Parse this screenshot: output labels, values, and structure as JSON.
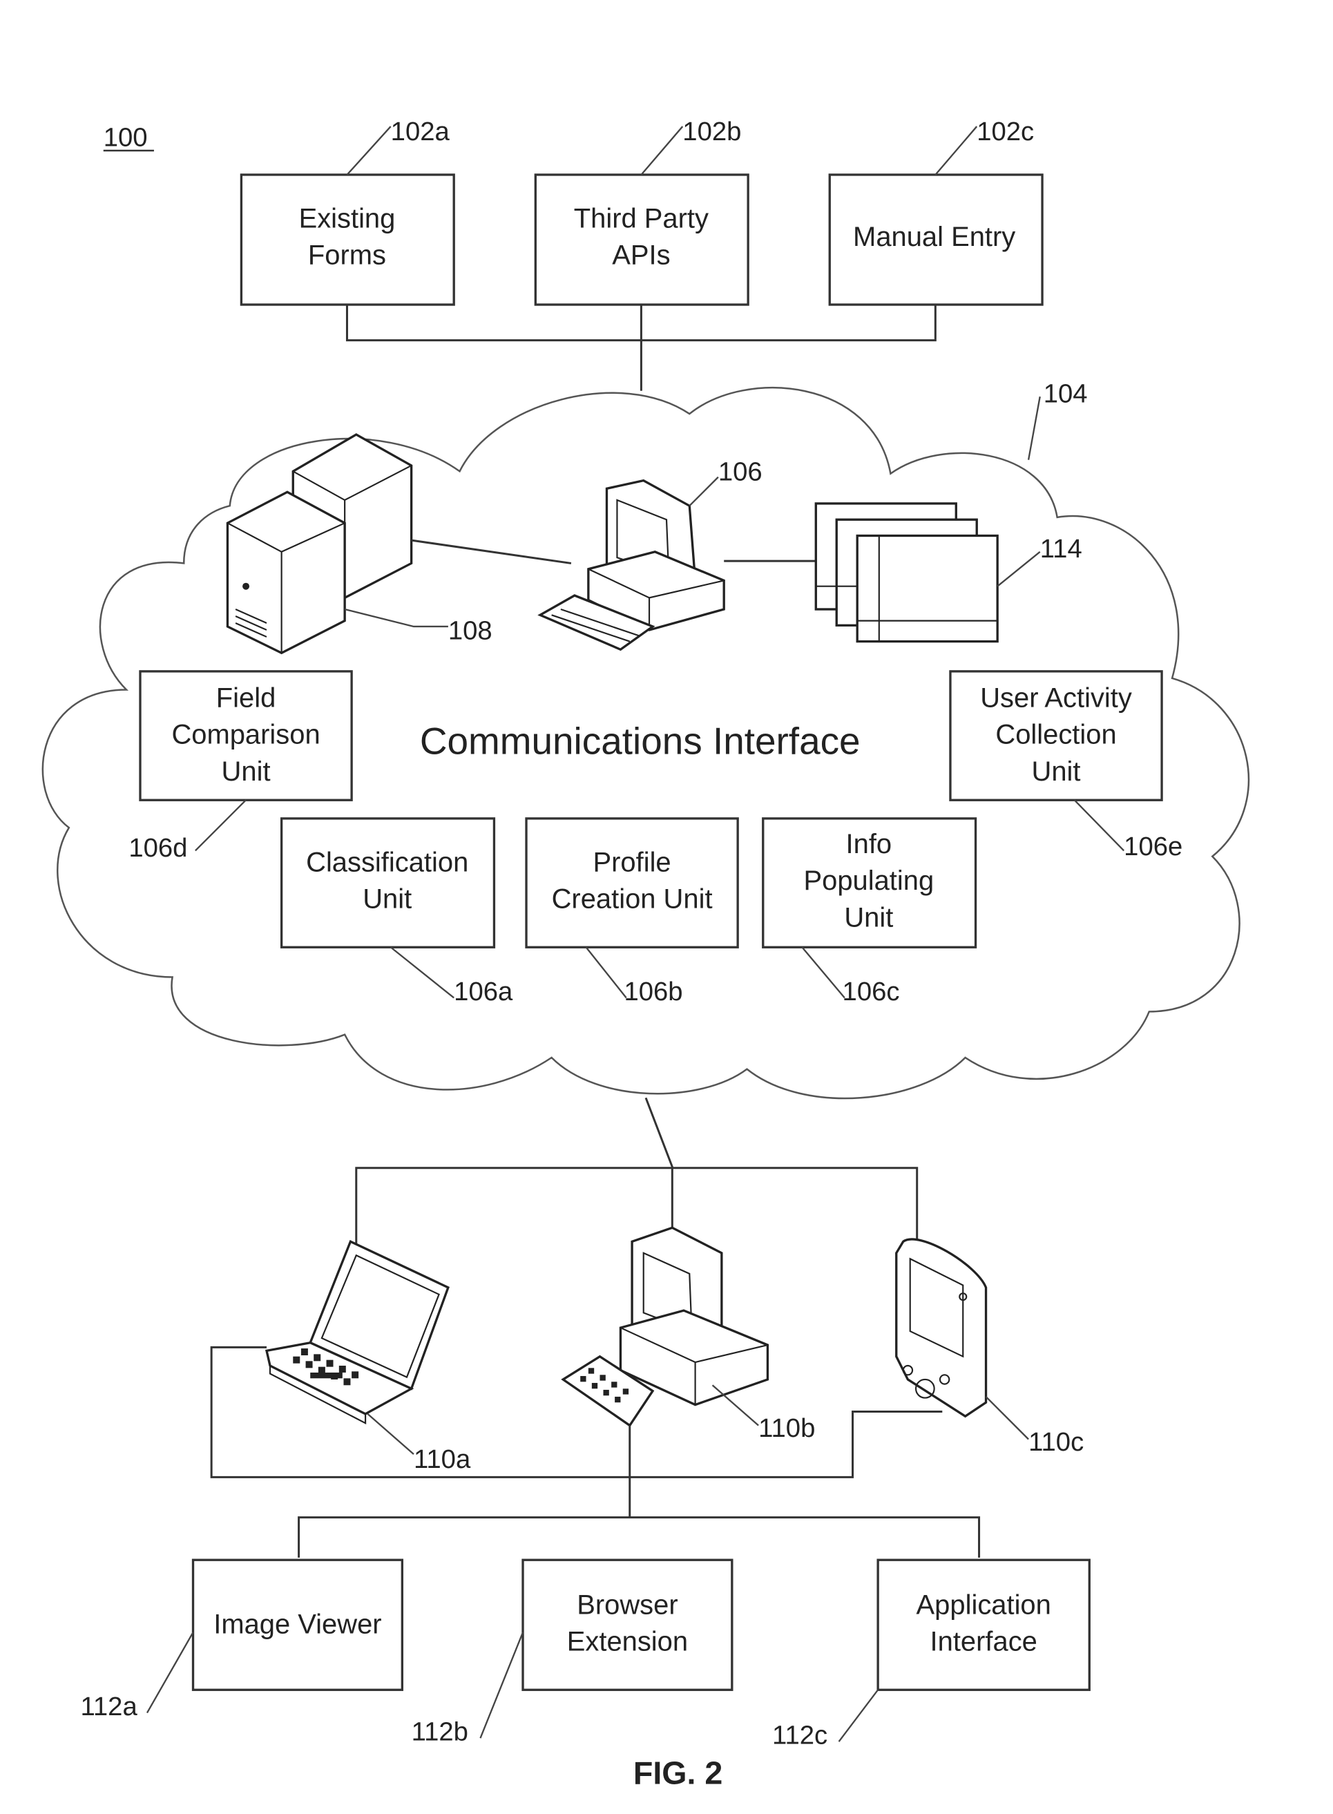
{
  "figure": {
    "system_ref": "100",
    "caption": "FIG. 2"
  },
  "sources": [
    {
      "ref": "102a",
      "lines": [
        "Existing",
        "Forms"
      ]
    },
    {
      "ref": "102b",
      "lines": [
        "Third Party",
        "APIs"
      ]
    },
    {
      "ref": "102c",
      "lines": [
        "Manual Entry"
      ]
    }
  ],
  "cloud": {
    "ref": "104",
    "title": "Communications Interface",
    "server_ref": "108",
    "computer_ref": "106",
    "documents_ref": "114",
    "units": [
      {
        "ref": "106d",
        "lines": [
          "Field",
          "Comparison",
          "Unit"
        ]
      },
      {
        "ref": "106e",
        "lines": [
          "User Activity",
          "Collection",
          "Unit"
        ]
      },
      {
        "ref": "106a",
        "lines": [
          "Classification",
          "Unit"
        ]
      },
      {
        "ref": "106b",
        "lines": [
          "Profile",
          "Creation Unit"
        ]
      },
      {
        "ref": "106c",
        "lines": [
          "Info",
          "Populating",
          "Unit"
        ]
      }
    ]
  },
  "devices": [
    {
      "ref": "110a",
      "type": "laptop-icon"
    },
    {
      "ref": "110b",
      "type": "desktop-computer-icon"
    },
    {
      "ref": "110c",
      "type": "handheld-device-icon"
    }
  ],
  "clients": [
    {
      "ref": "112a",
      "lines": [
        "Image Viewer"
      ]
    },
    {
      "ref": "112b",
      "lines": [
        "Browser",
        "Extension"
      ]
    },
    {
      "ref": "112c",
      "lines": [
        "Application",
        "Interface"
      ]
    }
  ]
}
